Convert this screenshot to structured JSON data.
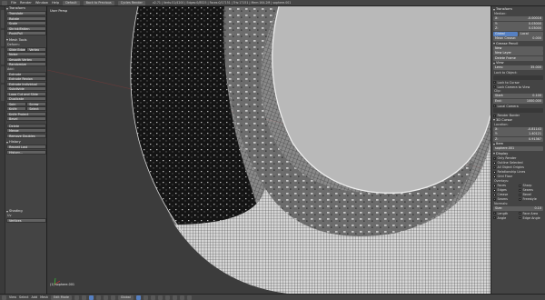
{
  "topbar": {
    "menu": [
      "File",
      "Render",
      "Window",
      "Help"
    ],
    "layout": "Default",
    "scene_button": "Back to Previous",
    "engine": "Cycles Render",
    "stats": "v2.71 | Verts:51/4200 | Edges:0/8525 | Faces:0/17151 | Tris:17151 | Mem:164.2M | sophere.001"
  },
  "toolshelf": {
    "transform_head": "Transform",
    "transform_buttons": [
      "Translate",
      "Rotate",
      "Scale",
      "Shrink/Fatten",
      "Push/Pull"
    ],
    "mesh_tools_head": "Mesh Tools",
    "deform_label": "Deform:",
    "slide_row": [
      "Slide Edge",
      "Vertex"
    ],
    "deform_buttons": [
      "Noise",
      "Smooth Vertex",
      "Randomize"
    ],
    "add_label": "Add:",
    "extrude_head": "Extrude",
    "add_buttons": [
      "Extrude Region",
      "Extrude Individual",
      "Subdivide",
      "Loop Cut and Slide",
      "Duplicate"
    ],
    "spin_row": [
      "Spin",
      "Screw"
    ],
    "knife_row": [
      "Knife",
      "Select"
    ],
    "add_buttons_2": [
      "Knife Project",
      "Bevel"
    ],
    "delete_head": "Delete",
    "remove_buttons": [
      "Merge",
      "Remove Doubles"
    ],
    "history_head": "History",
    "history_buttons": [
      "Repeat Last",
      "History..."
    ],
    "shading_head": "Shading",
    "uv_label": "Uv",
    "uv_value": "Vertices"
  },
  "viewport": {
    "label": "User Persp",
    "object_label": "(1) sophere.001"
  },
  "props": {
    "transform_head": "Transform",
    "median_label": "Median:",
    "x": [
      "X:",
      "-0.00016"
    ],
    "y": [
      "Y:",
      "0.03000"
    ],
    "z": [
      "Z:",
      "0.03000"
    ],
    "global_local": [
      "Global",
      "Local"
    ],
    "mean_crease": [
      "Mean Crease:",
      "0.000"
    ],
    "grease_head": "Grease Pencil",
    "new_button": "New",
    "new_layer": "New Layer",
    "delete_frame": "Delete Frame",
    "view_head": "View",
    "lens": [
      "Lens:",
      "35.000"
    ],
    "lock_label": "Lock to Object:",
    "lock_cursor": "Lock to Cursor",
    "lock_camera": "Lock Camera to View",
    "clip_label": "Clip:",
    "clip_start": [
      "Start:",
      "0.100"
    ],
    "clip_end": [
      "End:",
      "1000.000"
    ],
    "local_camera": "Local Camera",
    "render_border": "Render Border",
    "cursor_head": "3D Cursor",
    "location_label": "Location:",
    "cx": [
      "X:",
      "-0.81143"
    ],
    "cy": [
      "Y:",
      "1.40121"
    ],
    "cz": [
      "Z:",
      "0.91367"
    ],
    "item_head": "Item",
    "item_name": "sophere.001",
    "display_head": "Display",
    "only_render": "Only Render",
    "outline": "Outline Selected",
    "all_edges": "All Object Origins",
    "relationship": "Relationship Lines",
    "grid_floor": "Grid Floor",
    "overlays_label": "Overlays:",
    "overlays": [
      "Faces",
      "Sharp",
      "Edges",
      "Seams",
      "Crease",
      "Bevel",
      "Seams",
      "Freestyle"
    ],
    "normals_label": "Normals:",
    "size": [
      "Size:",
      "0.10"
    ],
    "numerics": [
      "Length",
      "Face Area",
      "Angle",
      "Edge Angle"
    ]
  },
  "bottombar": {
    "menu": [
      "View",
      "Select",
      "Add",
      "Mesh"
    ],
    "mode": "Edit Mode",
    "pivot": "Global"
  },
  "colors": {
    "panel": "#444444",
    "button": "#626262",
    "accent": "#5680c2",
    "viewport_bg": "#3c3c3c"
  }
}
